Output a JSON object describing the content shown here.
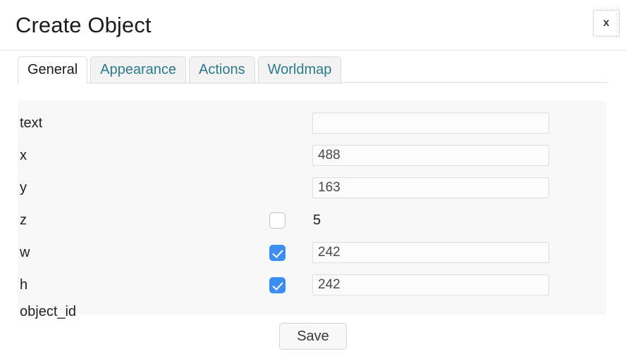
{
  "dialog": {
    "title": "Create Object",
    "close_label": "x"
  },
  "tabs": [
    {
      "label": "General",
      "active": true
    },
    {
      "label": "Appearance",
      "active": false
    },
    {
      "label": "Actions",
      "active": false
    },
    {
      "label": "Worldmap",
      "active": false
    }
  ],
  "fields": [
    {
      "label": "text",
      "type": "input",
      "value": "",
      "placeholder": "",
      "checkbox": null
    },
    {
      "label": "x",
      "type": "input",
      "value": "488",
      "placeholder": "",
      "checkbox": null
    },
    {
      "label": "y",
      "type": "input",
      "value": "163",
      "placeholder": "",
      "checkbox": null
    },
    {
      "label": "z",
      "type": "static",
      "value": "5",
      "placeholder": "",
      "checkbox": false
    },
    {
      "label": "w",
      "type": "input",
      "value": "242",
      "placeholder": "",
      "checkbox": true
    },
    {
      "label": "h",
      "type": "input",
      "value": "242",
      "placeholder": "",
      "checkbox": true
    },
    {
      "label": "object_id",
      "type": "none",
      "value": "",
      "placeholder": "",
      "checkbox": null
    }
  ],
  "footer": {
    "save_label": "Save"
  },
  "colors": {
    "tab_link": "#2b7a8c",
    "checkbox_checked": "#3c8ef2",
    "panel_bg": "#f8f8f8"
  }
}
